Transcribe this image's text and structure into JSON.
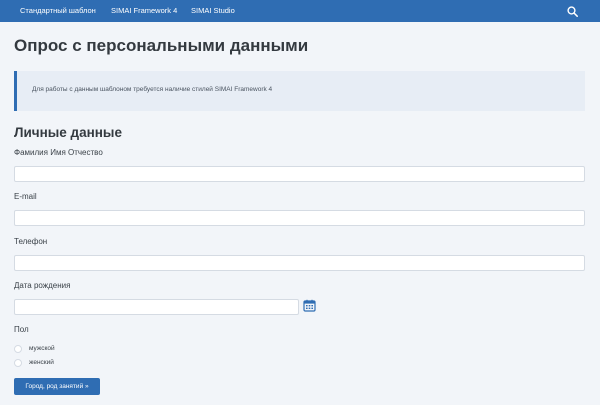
{
  "nav": {
    "items": [
      "Стандартный шаблон",
      "SIMAI Framework 4",
      "SIMAI Studio"
    ],
    "search_icon": "search-icon"
  },
  "page": {
    "title": "Опрос с персональными данными",
    "notice": "Для работы с данным шаблоном требуется наличие стилей SIMAI Framework 4"
  },
  "form": {
    "section_title": "Личные данные",
    "fields": {
      "fio": {
        "label": "Фамилия Имя Отчество",
        "value": ""
      },
      "email": {
        "label": "E-mail",
        "value": ""
      },
      "phone": {
        "label": "Телефон",
        "value": ""
      },
      "birthdate": {
        "label": "Дата рождения",
        "value": "",
        "icon": "calendar-icon"
      }
    },
    "gender": {
      "label": "Пол",
      "options": [
        "мужской",
        "женский"
      ],
      "selected": null
    },
    "next_button": "Город, род занятий »"
  },
  "colors": {
    "accent": "#2f6db3",
    "background": "#f2f5f9",
    "notice_bg": "#e7edf5"
  }
}
